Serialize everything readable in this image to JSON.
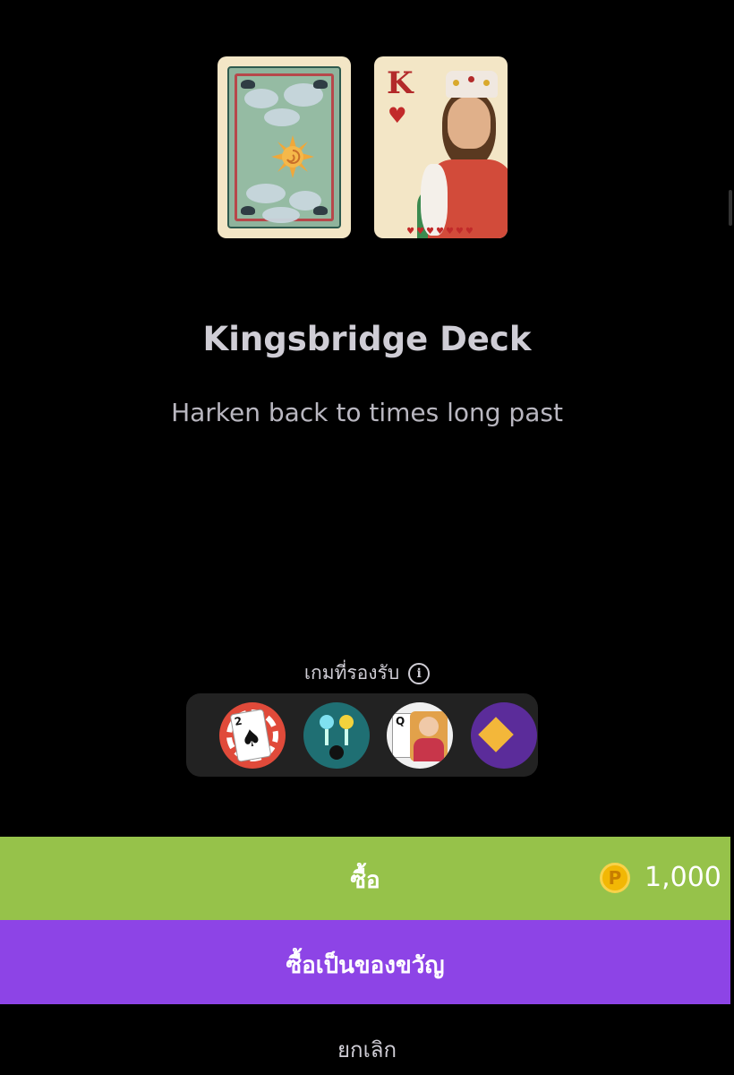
{
  "deck": {
    "title": "Kingsbridge Deck",
    "subtitle": "Harken back to times long past",
    "front_card_rank": "K",
    "front_card_suit": "♥"
  },
  "supported_games": {
    "label": "เกมที่รองรับ",
    "info_icon": "info-icon",
    "games": [
      {
        "name": "poker-chip-game-icon",
        "card_rank": "2"
      },
      {
        "name": "pins-game-icon"
      },
      {
        "name": "queen-cards-game-icon",
        "card_rank": "Q"
      },
      {
        "name": "purple-game-icon"
      }
    ]
  },
  "actions": {
    "buy_label": "ซื้อ",
    "price": "1,000",
    "coin_symbol": "P",
    "gift_label": "ซื้อเป็นของขวัญ",
    "cancel_label": "ยกเลิก"
  },
  "colors": {
    "buy": "#96c24a",
    "gift": "#8d44e6",
    "coin": "#f2b705",
    "background": "#000000"
  }
}
